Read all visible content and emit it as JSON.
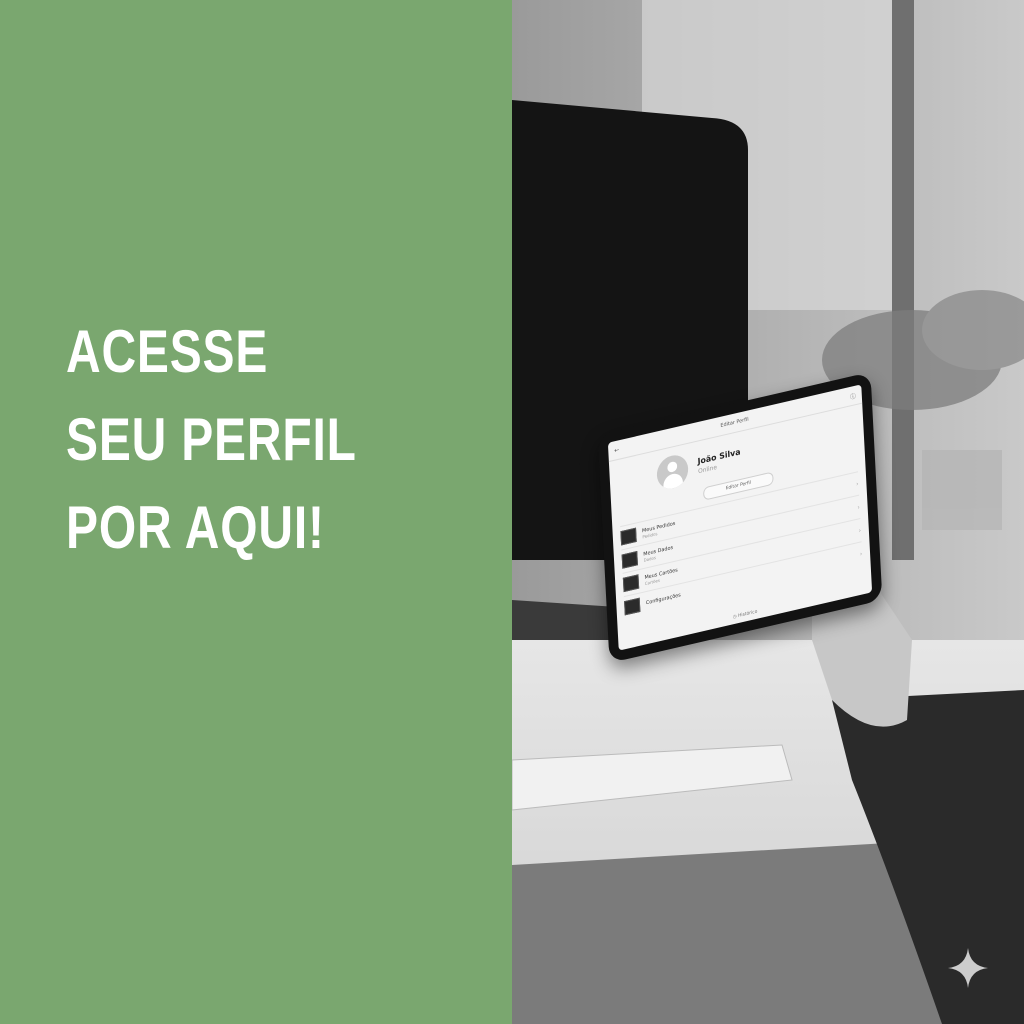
{
  "headline": {
    "lines": [
      "ACESSE",
      "SEU PERFIL",
      "POR AQUI!"
    ]
  },
  "colors": {
    "panel": "#7aa76f",
    "headline_text": "#ffffff"
  },
  "tablet": {
    "app_title": "Editar Perfil",
    "back_icon": "arrow-left-icon",
    "info_icon": "info-icon",
    "profile": {
      "name": "João Silva",
      "status": "Online"
    },
    "edit_button": "Editar Perfil",
    "items": [
      {
        "title": "Meus Pedidos",
        "subtitle": "Pedidos"
      },
      {
        "title": "Meus Dados",
        "subtitle": "Dados"
      },
      {
        "title": "Meus Cartões",
        "subtitle": "Cartões"
      },
      {
        "title": "Configurações",
        "subtitle": ""
      }
    ],
    "bottom_label": "Histórico"
  },
  "watermark": {
    "icon": "sparkle-icon"
  }
}
